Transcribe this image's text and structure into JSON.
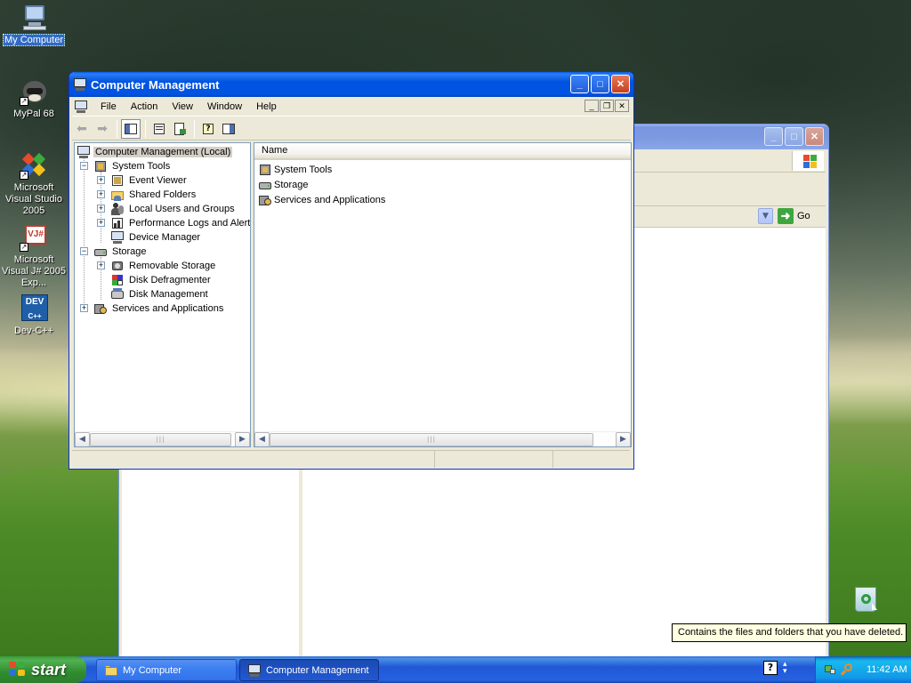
{
  "desktop": {
    "icons": [
      {
        "label": "My Computer"
      },
      {
        "label": "MyPal 68"
      },
      {
        "label": "Microsoft Visual Studio 2005"
      },
      {
        "label": "Microsoft Visual J# 2005 Exp..."
      },
      {
        "label": "Dev-C++"
      }
    ],
    "recycle_tooltip": "Contains the files and folders that you have deleted."
  },
  "background_window": {
    "go_label": "Go"
  },
  "main_window": {
    "title": "Computer Management",
    "menu": [
      "File",
      "Action",
      "View",
      "Window",
      "Help"
    ],
    "tree": [
      {
        "label": "Computer Management (Local)",
        "level": 0,
        "expander": "",
        "selected": true
      },
      {
        "label": "System Tools",
        "level": 1,
        "expander": "-"
      },
      {
        "label": "Event Viewer",
        "level": 2,
        "expander": "+"
      },
      {
        "label": "Shared Folders",
        "level": 2,
        "expander": "+"
      },
      {
        "label": "Local Users and Groups",
        "level": 2,
        "expander": "+"
      },
      {
        "label": "Performance Logs and Alerts",
        "level": 2,
        "expander": "+"
      },
      {
        "label": "Device Manager",
        "level": 2,
        "expander": ""
      },
      {
        "label": "Storage",
        "level": 1,
        "expander": "-"
      },
      {
        "label": "Removable Storage",
        "level": 2,
        "expander": "+"
      },
      {
        "label": "Disk Defragmenter",
        "level": 2,
        "expander": ""
      },
      {
        "label": "Disk Management",
        "level": 2,
        "expander": ""
      },
      {
        "label": "Services and Applications",
        "level": 1,
        "expander": "+"
      }
    ],
    "list_header": "Name",
    "list_items": [
      "System Tools",
      "Storage",
      "Services and Applications"
    ]
  },
  "taskbar": {
    "start_label": "start",
    "tasks": [
      {
        "label": "My Computer",
        "active": false
      },
      {
        "label": "Computer Management",
        "active": true
      }
    ],
    "clock": "11:42 AM"
  }
}
